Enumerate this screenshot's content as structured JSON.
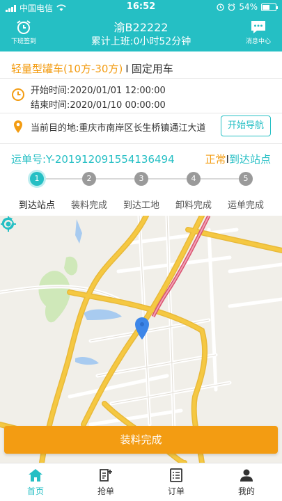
{
  "status_bar": {
    "carrier": "中国电信",
    "time": "16:52",
    "battery": "54%"
  },
  "header": {
    "left_button_label": "下班签到",
    "title": "渝B22222",
    "subtitle": "累计上班:0小时52分钟",
    "right_button_label": "消息中心",
    "color": "#25bfc4"
  },
  "vehicle": {
    "type": "轻量型罐车(10方-30方)",
    "separator": "I",
    "kind": "固定用车"
  },
  "schedule": {
    "start": "开始时间:2020/01/01 12:00:00",
    "end": "结束时间:2020/01/10 00:00:00"
  },
  "destination": {
    "text": "当前目的地:重庆市南岸区长生桥镇通江大道",
    "nav_button_label": "开始导航"
  },
  "waybill": {
    "number": "运单号:Y-201912091554136494",
    "status_normal": "正常",
    "status_sep": "I",
    "status_stage": "到达站点"
  },
  "steps": [
    {
      "num": "1",
      "label": "到达站点",
      "active": true
    },
    {
      "num": "2",
      "label": "装料完成",
      "active": false
    },
    {
      "num": "3",
      "label": "到达工地",
      "active": false
    },
    {
      "num": "4",
      "label": "卸料完成",
      "active": false
    },
    {
      "num": "5",
      "label": "运单完成",
      "active": false
    }
  ],
  "action_button_label": "装料完成",
  "tabs": [
    {
      "label": "首页",
      "icon": "home-icon",
      "active": true
    },
    {
      "label": "抢单",
      "icon": "grab-order-icon",
      "active": false
    },
    {
      "label": "订单",
      "icon": "order-list-icon",
      "active": false
    },
    {
      "label": "我的",
      "icon": "profile-icon",
      "active": false
    }
  ],
  "colors": {
    "accent": "#25bfc4",
    "orange": "#f39c12",
    "road": "#f5c842",
    "map_bg": "#f1efe9"
  }
}
